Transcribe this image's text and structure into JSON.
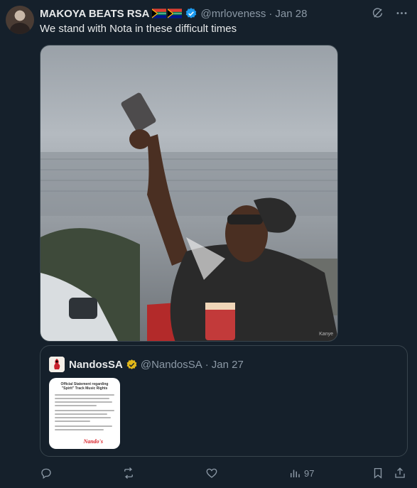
{
  "tweet": {
    "display_name": "MAKOYA BEATS RSA",
    "flag_icons": [
      "south-africa-flag-icon",
      "south-africa-flag-icon"
    ],
    "handle": "@mrloveness",
    "separator": "·",
    "time": "Jan 28",
    "text": "We stand with Nota in these difficult times",
    "media": {
      "watermark": "Kanye"
    }
  },
  "quote": {
    "display_name": "NandosSA",
    "handle": "@NandosSA",
    "separator": "·",
    "time": "Jan 27",
    "thumbnail": {
      "title_line1": "Official Statement regarding",
      "title_line2": "\"Spirit\" Track Music Rights",
      "logo": "Nando's"
    }
  },
  "actions": {
    "reply_icon": "reply-icon",
    "repost_icon": "repost-icon",
    "like_icon": "like-icon",
    "views_icon": "views-icon",
    "views_count": "97",
    "bookmark_icon": "bookmark-icon",
    "share_icon": "share-icon"
  },
  "colors": {
    "background": "#15202b",
    "text_primary": "#e7e9ea",
    "text_secondary": "#8b98a5",
    "border": "#38444d",
    "verified_blue": "#1d9bf0",
    "verified_gold": "#e2b719",
    "nandos_red": "#d8232a"
  }
}
